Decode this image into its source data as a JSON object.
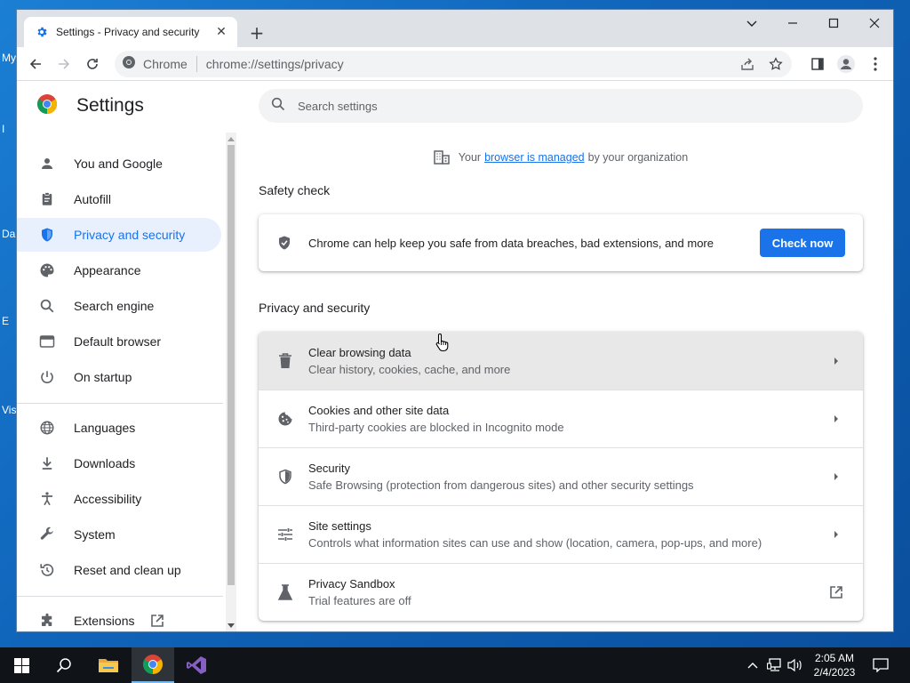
{
  "desktop": {
    "icon_labels": [
      "My",
      "I",
      "Da",
      "E",
      "Vis"
    ]
  },
  "browser": {
    "tab": {
      "title": "Settings - Privacy and security"
    },
    "omnibox": {
      "site": "Chrome",
      "url": "chrome://settings/privacy"
    }
  },
  "settings": {
    "title": "Settings",
    "search_placeholder": "Search settings",
    "nav": [
      {
        "label": "You and Google",
        "icon": "person-icon"
      },
      {
        "label": "Autofill",
        "icon": "clipboard-icon"
      },
      {
        "label": "Privacy and security",
        "icon": "shield-icon",
        "active": true
      },
      {
        "label": "Appearance",
        "icon": "palette-icon"
      },
      {
        "label": "Search engine",
        "icon": "search-icon"
      },
      {
        "label": "Default browser",
        "icon": "browser-window-icon"
      },
      {
        "label": "On startup",
        "icon": "power-icon"
      },
      {
        "label": "Languages",
        "icon": "globe-icon"
      },
      {
        "label": "Downloads",
        "icon": "download-icon"
      },
      {
        "label": "Accessibility",
        "icon": "accessibility-icon"
      },
      {
        "label": "System",
        "icon": "wrench-icon"
      },
      {
        "label": "Reset and clean up",
        "icon": "history-icon"
      },
      {
        "label": "Extensions",
        "icon": "puzzle-icon"
      }
    ],
    "managed": {
      "prefix": "Your",
      "link": "browser is managed",
      "suffix": "by your organization"
    },
    "safety_check": {
      "title": "Safety check",
      "text": "Chrome can help keep you safe from data breaches, bad extensions, and more",
      "button": "Check now"
    },
    "privacy": {
      "title": "Privacy and security",
      "rows": [
        {
          "title": "Clear browsing data",
          "subtitle": "Clear history, cookies, cache, and more",
          "icon": "trash-icon"
        },
        {
          "title": "Cookies and other site data",
          "subtitle": "Third-party cookies are blocked in Incognito mode",
          "icon": "cookie-icon"
        },
        {
          "title": "Security",
          "subtitle": "Safe Browsing (protection from dangerous sites) and other security settings",
          "icon": "shield-icon"
        },
        {
          "title": "Site settings",
          "subtitle": "Controls what information sites can use and show (location, camera, pop-ups, and more)",
          "icon": "sliders-icon"
        },
        {
          "title": "Privacy Sandbox",
          "subtitle": "Trial features are off",
          "icon": "flask-icon"
        }
      ]
    }
  },
  "taskbar": {
    "time": "2:05 AM",
    "date": "2/4/2023"
  },
  "colors": {
    "accent": "#1a73e8",
    "active_nav_bg": "#e8f0fe",
    "taskbar": "#101418"
  }
}
